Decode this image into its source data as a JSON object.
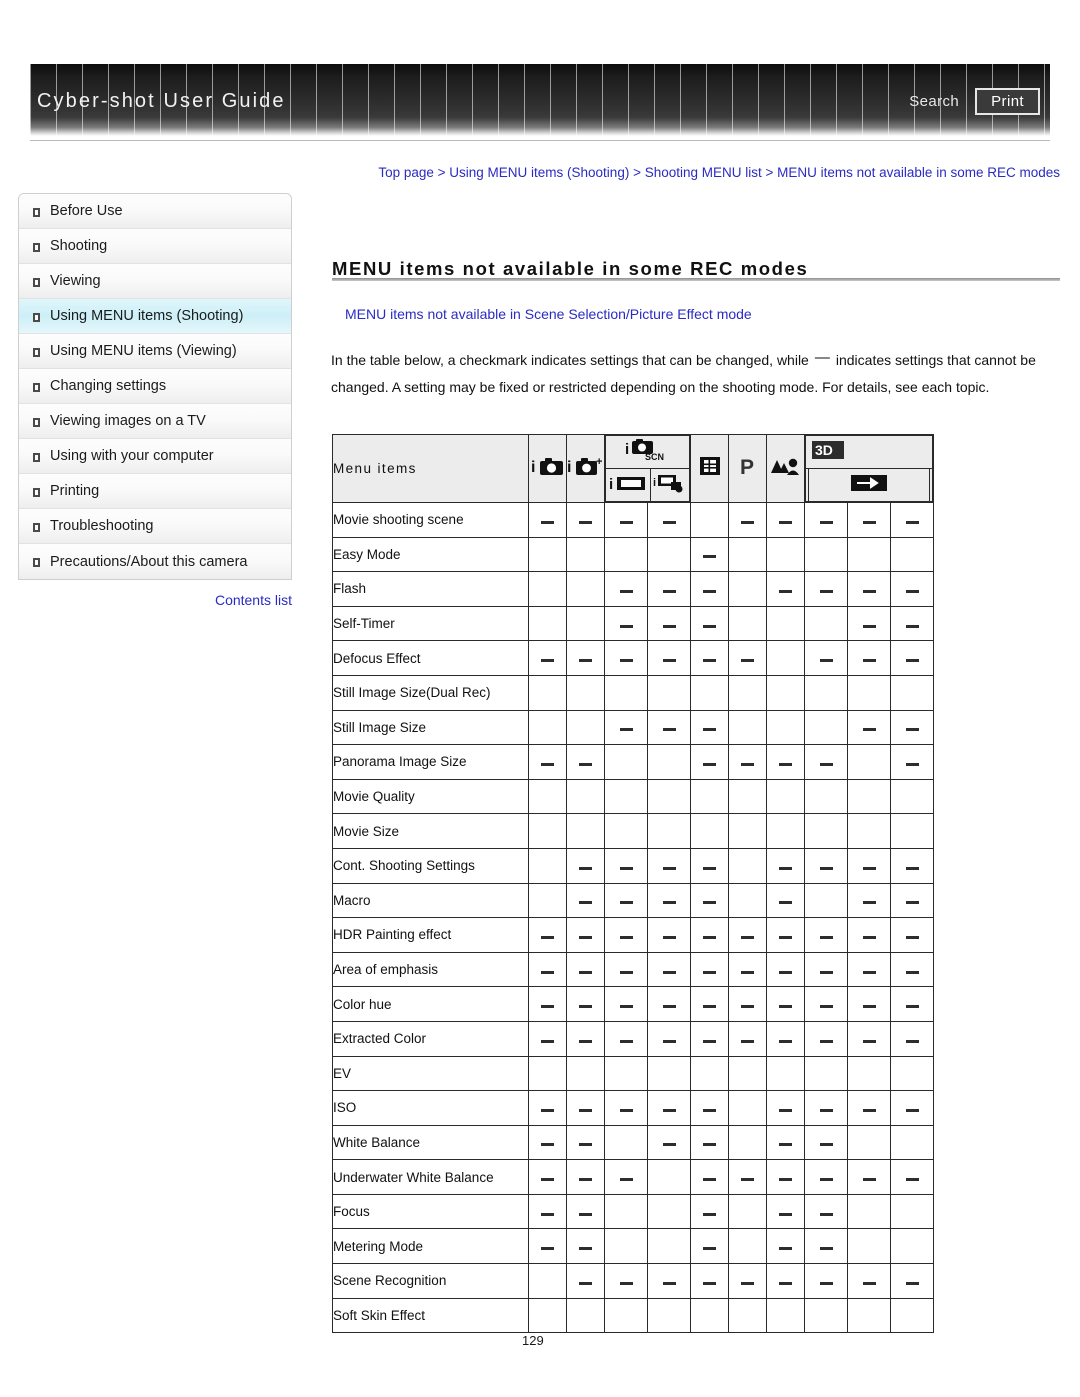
{
  "banner": {
    "title": "Cyber-shot User Guide",
    "search_label": "Search",
    "print_label": "Print"
  },
  "breadcrumb": {
    "text": "Top page > Using MENU items (Shooting) > Shooting MENU list > MENU items not available in some REC modes"
  },
  "sidebar": {
    "items": [
      {
        "label": "Before Use",
        "active": false
      },
      {
        "label": "Shooting",
        "active": false
      },
      {
        "label": "Viewing",
        "active": false
      },
      {
        "label": "Using MENU items (Shooting)",
        "active": true
      },
      {
        "label": "Using MENU items (Viewing)",
        "active": false
      },
      {
        "label": "Changing settings",
        "active": false
      },
      {
        "label": "Viewing images on a TV",
        "active": false
      },
      {
        "label": "Using with your computer",
        "active": false
      },
      {
        "label": "Printing",
        "active": false
      },
      {
        "label": "Troubleshooting",
        "active": false
      },
      {
        "label": "Precautions/About this camera",
        "active": false
      }
    ],
    "contents_list_label": "Contents list"
  },
  "main": {
    "page_title": "MENU items not available in some REC modes",
    "section_link": "MENU items not available in Scene Selection/Picture Effect mode",
    "intro_part1": "In the table below, a checkmark indicates settings that can be changed, while",
    "intro_dash": "—",
    "intro_part2": "indicates settings that cannot be changed. A setting may be fixed or restricted depending on the shooting mode. For details, see each topic.",
    "page_number": "129"
  },
  "table": {
    "row_header_label": "Menu items",
    "columns": [
      {
        "id": "intelligent-auto",
        "icon": "intelligent-auto-icon",
        "label": "i Auto"
      },
      {
        "id": "superior-auto",
        "icon": "superior-auto-icon",
        "label": "i Auto+"
      },
      {
        "id": "scene-selection",
        "icon": "scene-selection-icon",
        "label": "iSCN"
      },
      {
        "id": "sweep-panorama",
        "icon": "sweep-panorama-icon",
        "label": "Sweep Panorama"
      },
      {
        "id": "movie-mode",
        "icon": "movie-mode-icon",
        "label": "Movie"
      },
      {
        "id": "program-auto",
        "icon": "program-auto-icon",
        "label": "P"
      },
      {
        "id": "background-defocus",
        "icon": "background-defocus-icon",
        "label": "Background Defocus"
      },
      {
        "id": "3d-still-image",
        "icon": "3d-icon",
        "label": "3D"
      },
      {
        "id": "3d-sweep-panorama",
        "icon": "3d-sweep-icon",
        "label": "3D Sweep Panorama"
      },
      {
        "id": "3d-sweep-multi-angle",
        "icon": "3d-multi-angle-icon",
        "label": "3D Sweep Multi Angle"
      }
    ],
    "dash_symbol": "—",
    "rows": [
      {
        "label": "Movie shooting scene",
        "cells": [
          1,
          1,
          1,
          1,
          0,
          1,
          1,
          1,
          1,
          1
        ]
      },
      {
        "label": "Easy Mode",
        "cells": [
          0,
          0,
          0,
          0,
          1,
          0,
          0,
          0,
          0,
          0
        ]
      },
      {
        "label": "Flash",
        "cells": [
          0,
          0,
          1,
          1,
          1,
          0,
          1,
          1,
          1,
          1
        ]
      },
      {
        "label": "Self-Timer",
        "cells": [
          0,
          0,
          1,
          1,
          1,
          0,
          0,
          0,
          1,
          1
        ]
      },
      {
        "label": "Defocus Effect",
        "cells": [
          1,
          1,
          1,
          1,
          1,
          1,
          0,
          1,
          1,
          1
        ]
      },
      {
        "label": "Still Image Size(Dual Rec)",
        "cells": [
          0,
          0,
          0,
          0,
          0,
          0,
          0,
          0,
          0,
          0
        ]
      },
      {
        "label": "Still Image Size",
        "cells": [
          0,
          0,
          1,
          1,
          1,
          0,
          0,
          0,
          1,
          1
        ]
      },
      {
        "label": "Panorama Image Size",
        "cells": [
          1,
          1,
          0,
          0,
          1,
          1,
          1,
          1,
          0,
          1
        ]
      },
      {
        "label": "Movie Quality",
        "cells": [
          0,
          0,
          0,
          0,
          0,
          0,
          0,
          0,
          0,
          0
        ]
      },
      {
        "label": "Movie Size",
        "cells": [
          0,
          0,
          0,
          0,
          0,
          0,
          0,
          0,
          0,
          0
        ]
      },
      {
        "label": "Cont. Shooting Settings",
        "cells": [
          0,
          1,
          1,
          1,
          1,
          0,
          1,
          1,
          1,
          1
        ]
      },
      {
        "label": "Macro",
        "cells": [
          0,
          1,
          1,
          1,
          1,
          0,
          1,
          0,
          1,
          1
        ]
      },
      {
        "label": "HDR Painting effect",
        "cells": [
          1,
          1,
          1,
          1,
          1,
          1,
          1,
          1,
          1,
          1
        ]
      },
      {
        "label": "Area of emphasis",
        "cells": [
          1,
          1,
          1,
          1,
          1,
          1,
          1,
          1,
          1,
          1
        ]
      },
      {
        "label": "Color hue",
        "cells": [
          1,
          1,
          1,
          1,
          1,
          1,
          1,
          1,
          1,
          1
        ]
      },
      {
        "label": "Extracted Color",
        "cells": [
          1,
          1,
          1,
          1,
          1,
          1,
          1,
          1,
          1,
          1
        ]
      },
      {
        "label": "EV",
        "cells": [
          0,
          0,
          0,
          0,
          0,
          0,
          0,
          0,
          0,
          0
        ]
      },
      {
        "label": "ISO",
        "cells": [
          1,
          1,
          1,
          1,
          1,
          0,
          1,
          1,
          1,
          1
        ]
      },
      {
        "label": "White Balance",
        "cells": [
          1,
          1,
          0,
          1,
          1,
          0,
          1,
          1,
          0,
          0
        ]
      },
      {
        "label": "Underwater White Balance",
        "cells": [
          1,
          1,
          1,
          0,
          1,
          1,
          1,
          1,
          1,
          1
        ]
      },
      {
        "label": "Focus",
        "cells": [
          1,
          1,
          0,
          0,
          1,
          0,
          1,
          1,
          0,
          0
        ]
      },
      {
        "label": "Metering Mode",
        "cells": [
          1,
          1,
          0,
          0,
          1,
          0,
          1,
          1,
          0,
          0
        ]
      },
      {
        "label": "Scene Recognition",
        "cells": [
          0,
          1,
          1,
          1,
          1,
          1,
          1,
          1,
          1,
          1
        ]
      },
      {
        "label": "Soft Skin Effect",
        "cells": [
          0,
          0,
          0,
          0,
          0,
          0,
          0,
          0,
          0,
          0
        ]
      }
    ]
  },
  "colors": {
    "link": "#2b2bc4",
    "active_nav": "#cdeff7",
    "banner_dark": "#1d1d1d",
    "table_header_bg": "#ececec"
  }
}
